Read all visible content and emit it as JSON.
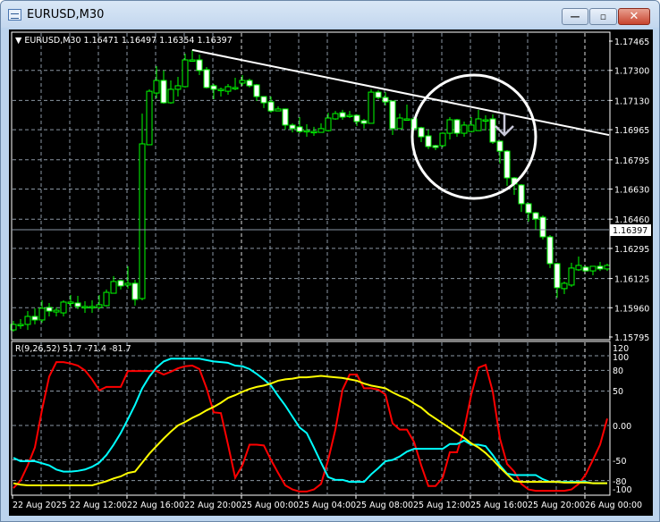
{
  "window": {
    "title": "EURUSD,M30",
    "minimize_glyph": "—",
    "maximize_glyph": "▫",
    "close_glyph": "✕"
  },
  "chart_data": [
    {
      "type": "candlestick",
      "header": {
        "arrow": "▼",
        "symbol": "EURUSD,M30",
        "ohlc": "1.16471 1.16497 1.16354 1.16397"
      },
      "ylim": [
        1.15795,
        1.17465
      ],
      "price_ticks": [
        "1.17465",
        "1.17300",
        "1.17130",
        "1.16965",
        "1.16795",
        "1.16630",
        "1.16460",
        "1.16295",
        "1.16125",
        "1.15960",
        "1.15795"
      ],
      "current_price": "1.16397",
      "time_labels": [
        "22 Aug 2025",
        "22 Aug 12:00",
        "22 Aug 16:00",
        "22 Aug 20:00",
        "25 Aug 00:00",
        "25 Aug 04:00",
        "25 Aug 08:00",
        "25 Aug 12:00",
        "25 Aug 16:00",
        "25 Aug 20:00",
        "26 Aug 00:00"
      ],
      "grid": true,
      "colors": {
        "background": "#000000",
        "bull": "#00ff00",
        "bear_body": "#ffffff",
        "grid": "#8a96a3",
        "trendline": "#ffffff"
      },
      "candles_ohlc": [
        [
          1.15835,
          1.15886,
          1.15825,
          1.15866
        ],
        [
          1.15866,
          1.15896,
          1.15841,
          1.15866
        ],
        [
          1.15866,
          1.15941,
          1.15835,
          1.15911
        ],
        [
          1.15911,
          1.15957,
          1.15866,
          1.15891
        ],
        [
          1.15891,
          1.16002,
          1.15876,
          1.15957
        ],
        [
          1.15962,
          1.15987,
          1.15911,
          1.15941
        ],
        [
          1.15936,
          1.15962,
          1.15911,
          1.15946
        ],
        [
          1.15931,
          1.16002,
          1.15911,
          1.15992
        ],
        [
          1.15992,
          1.16032,
          1.15962,
          1.15992
        ],
        [
          1.15987,
          1.16027,
          1.15952,
          1.15967
        ],
        [
          1.15967,
          1.15997,
          1.15931,
          1.15967
        ],
        [
          1.15967,
          1.16002,
          1.15931,
          1.15967
        ],
        [
          1.15962,
          1.16032,
          1.15952,
          1.15977
        ],
        [
          1.15972,
          1.16063,
          1.15967,
          1.16047
        ],
        [
          1.16042,
          1.16138,
          1.16042,
          1.16108
        ],
        [
          1.16113,
          1.16118,
          1.16063,
          1.16083
        ],
        [
          1.16088,
          1.16194,
          1.16068,
          1.16098
        ],
        [
          1.16098,
          1.16118,
          1.15972,
          1.16007
        ],
        [
          1.16012,
          1.17056,
          1.16002,
          1.16885
        ],
        [
          1.1688,
          1.17193,
          1.1688,
          1.17182
        ],
        [
          1.17172,
          1.17324,
          1.17142,
          1.17243
        ],
        [
          1.17243,
          1.17299,
          1.17112,
          1.17117
        ],
        [
          1.17117,
          1.17243,
          1.17112,
          1.17193
        ],
        [
          1.17193,
          1.17263,
          1.17152,
          1.17213
        ],
        [
          1.17208,
          1.17394,
          1.17203,
          1.17359
        ],
        [
          1.17359,
          1.17415,
          1.17349,
          1.17359
        ],
        [
          1.17359,
          1.17389,
          1.17273,
          1.17299
        ],
        [
          1.17304,
          1.17319,
          1.17198,
          1.17203
        ],
        [
          1.17213,
          1.17223,
          1.17137,
          1.17193
        ],
        [
          1.17193,
          1.17203,
          1.17152,
          1.17193
        ],
        [
          1.17182,
          1.17223,
          1.17162,
          1.17208
        ],
        [
          1.17203,
          1.17258,
          1.17188,
          1.17203
        ],
        [
          1.17228,
          1.17273,
          1.17213,
          1.17243
        ],
        [
          1.17243,
          1.17253,
          1.17203,
          1.17213
        ],
        [
          1.17218,
          1.17223,
          1.17127,
          1.17152
        ],
        [
          1.17152,
          1.17152,
          1.17087,
          1.17117
        ],
        [
          1.17122,
          1.17152,
          1.17061,
          1.17071
        ],
        [
          1.17071,
          1.17097,
          1.17071,
          1.17082
        ],
        [
          1.17082,
          1.17082,
          1.16965,
          1.16991
        ],
        [
          1.16991,
          1.17001,
          1.1695,
          1.16971
        ],
        [
          1.16981,
          1.17036,
          1.16945,
          1.16955
        ],
        [
          1.1696,
          1.16996,
          1.16925,
          1.1696
        ],
        [
          1.16955,
          1.16981,
          1.1693,
          1.16955
        ],
        [
          1.1695,
          1.17001,
          1.1695,
          1.16971
        ],
        [
          1.1696,
          1.17061,
          1.16955,
          1.17031
        ],
        [
          1.17026,
          1.17071,
          1.17021,
          1.17056
        ],
        [
          1.17061,
          1.17077,
          1.17021,
          1.17036
        ],
        [
          1.17046,
          1.17071,
          1.17031,
          1.17046
        ],
        [
          1.17046,
          1.17051,
          1.16986,
          1.17011
        ],
        [
          1.17016,
          1.17026,
          1.16971,
          1.17001
        ],
        [
          1.17001,
          1.17193,
          1.17001,
          1.17177
        ],
        [
          1.17177,
          1.17188,
          1.17137,
          1.17147
        ],
        [
          1.17147,
          1.17177,
          1.17102,
          1.17122
        ],
        [
          1.17127,
          1.17127,
          1.16935,
          1.16971
        ],
        [
          1.16971,
          1.17056,
          1.16971,
          1.17031
        ],
        [
          1.17026,
          1.17107,
          1.17021,
          1.17026
        ],
        [
          1.17026,
          1.17036,
          1.1696,
          1.16971
        ],
        [
          1.16976,
          1.16981,
          1.16895,
          1.16925
        ],
        [
          1.1693,
          1.16965,
          1.16855,
          1.1687
        ],
        [
          1.16875,
          1.1688,
          1.1685,
          1.16865
        ],
        [
          1.16875,
          1.1695,
          1.16865,
          1.16945
        ],
        [
          1.16945,
          1.17036,
          1.1691,
          1.17021
        ],
        [
          1.17021,
          1.17026,
          1.16925,
          1.16945
        ],
        [
          1.16945,
          1.17011,
          1.16925,
          1.16991
        ],
        [
          1.16955,
          1.17036,
          1.1695,
          1.16991
        ],
        [
          1.1696,
          1.17077,
          1.1696,
          1.17026
        ],
        [
          1.17021,
          1.17046,
          1.1696,
          1.17021
        ],
        [
          1.17026,
          1.17051,
          1.16885,
          1.16895
        ],
        [
          1.169,
          1.169,
          1.16774,
          1.16844
        ],
        [
          1.16844,
          1.1685,
          1.16648,
          1.16693
        ],
        [
          1.16693,
          1.16698,
          1.16597,
          1.16658
        ],
        [
          1.16653,
          1.16658,
          1.16501,
          1.16547
        ],
        [
          1.16547,
          1.16552,
          1.16446,
          1.16496
        ],
        [
          1.16496,
          1.16501,
          1.16401,
          1.16461
        ],
        [
          1.16471,
          1.16481,
          1.16345,
          1.1636
        ],
        [
          1.1636,
          1.1637,
          1.16184,
          1.16209
        ],
        [
          1.16209,
          1.16214,
          1.16017,
          1.16073
        ],
        [
          1.16068,
          1.16108,
          1.16037,
          1.16098
        ],
        [
          1.16088,
          1.16214,
          1.16078,
          1.16184
        ],
        [
          1.16174,
          1.16249,
          1.16168,
          1.16199
        ],
        [
          1.16189,
          1.16194,
          1.16168,
          1.16168
        ],
        [
          1.16168,
          1.16194,
          1.16143,
          1.16194
        ],
        [
          1.16194,
          1.16219,
          1.16168,
          1.16179
        ],
        [
          1.16179,
          1.16209,
          1.16168,
          1.16199
        ]
      ],
      "trendline": {
        "from_bar": 25,
        "from_price": 1.17415,
        "to_bar": 83,
        "to_price": 1.16935
      },
      "annotations": [
        "circle-highlight",
        "down-arrow-sell-signal"
      ]
    },
    {
      "type": "line",
      "header": "R(9,26,52) 51.7 -71.4 -81.7",
      "ylim": [
        -96,
        122
      ],
      "ticks": [
        "120",
        "100",
        "80",
        "50",
        "0.00",
        "-50",
        "-80",
        "-100"
      ],
      "grid": true,
      "series": [
        {
          "color": "#ff0000",
          "values": [
            -91,
            -80,
            -58,
            -32,
            23,
            71,
            92,
            92,
            90,
            87,
            80,
            67,
            51,
            56,
            56,
            56,
            79,
            79,
            79,
            79,
            79,
            74,
            78,
            83,
            86,
            87,
            82,
            54,
            19,
            18,
            -28,
            -76,
            -58,
            -28,
            -28,
            -29,
            -50,
            -69,
            -87,
            -93,
            -96,
            -96,
            -93,
            -85,
            -50,
            -6,
            52,
            74,
            74,
            54,
            54,
            52,
            45,
            3,
            -6,
            -6,
            -24,
            -58,
            -88,
            -88,
            -76,
            -39,
            -39,
            -6,
            45,
            84,
            88,
            49,
            -19,
            -56,
            -67,
            -85,
            -93,
            -95,
            -95,
            -95,
            -95,
            -95,
            -93,
            -85,
            -71,
            -50,
            -28,
            10
          ]
        },
        {
          "color": "#00ffff",
          "values": [
            -47,
            -52,
            -52,
            -52,
            -55,
            -58,
            -64,
            -67,
            -67,
            -66,
            -64,
            -60,
            -54,
            -43,
            -28,
            -11,
            9,
            30,
            54,
            71,
            84,
            93,
            97,
            97,
            97,
            97,
            97,
            95,
            93,
            92,
            91,
            87,
            86,
            82,
            75,
            67,
            58,
            43,
            29,
            13,
            -3,
            -11,
            -32,
            -54,
            -75,
            -79,
            -79,
            -82,
            -82,
            -82,
            -71,
            -62,
            -52,
            -50,
            -45,
            -38,
            -34,
            -34,
            -34,
            -34,
            -34,
            -27,
            -27,
            -22,
            -28,
            -28,
            -30,
            -43,
            -58,
            -70,
            -72,
            -72,
            -72,
            -72,
            -78,
            -82,
            -82,
            -82,
            -82,
            -82,
            -82,
            -84,
            -84,
            -84
          ]
        },
        {
          "color": "#ffff00",
          "values": [
            -84,
            -86,
            -87,
            -87,
            -87,
            -87,
            -87,
            -87,
            -87,
            -87,
            -87,
            -87,
            -84,
            -81,
            -77,
            -74,
            -69,
            -67,
            -54,
            -41,
            -30,
            -19,
            -9,
            0,
            5,
            11,
            16,
            22,
            27,
            33,
            40,
            44,
            49,
            53,
            56,
            58,
            61,
            65,
            67,
            68,
            70,
            70,
            71,
            72,
            71,
            70,
            69,
            67,
            65,
            61,
            58,
            56,
            54,
            48,
            43,
            39,
            32,
            26,
            17,
            10,
            3,
            -4,
            -11,
            -18,
            -26,
            -32,
            -40,
            -50,
            -61,
            -71,
            -81,
            -82,
            -82,
            -82,
            -82,
            -82,
            -82,
            -83,
            -83,
            -83,
            -83,
            -84,
            -84,
            -84
          ]
        }
      ]
    }
  ]
}
